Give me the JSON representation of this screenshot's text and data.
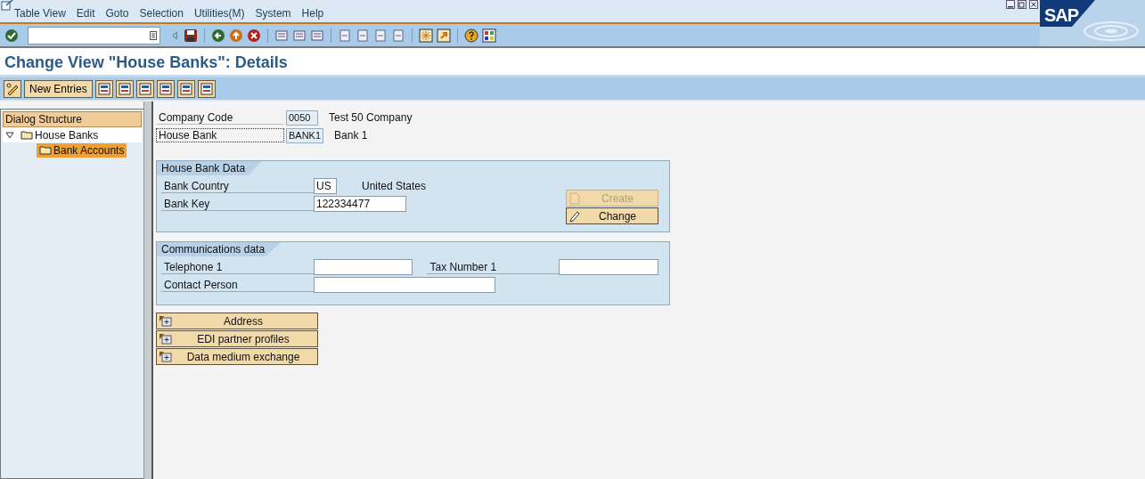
{
  "logo": "SAP",
  "menu": [
    "Table View",
    "Edit",
    "Goto",
    "Selection",
    "Utilities(M)",
    "System",
    "Help"
  ],
  "title": "Change View \"House Banks\": Details",
  "app_toolbar": {
    "new_entries": "New Entries"
  },
  "dialog_structure": {
    "title": "Dialog Structure",
    "items": [
      {
        "label": "House Banks",
        "expanded": true,
        "selected": false,
        "children": [
          {
            "label": "Bank Accounts",
            "selected": true
          }
        ]
      }
    ]
  },
  "header_fields": [
    {
      "label": "Company Code",
      "value": "0050",
      "description": "Test 50 Company",
      "focused": false
    },
    {
      "label": "House Bank",
      "value": "BANK1",
      "description": "Bank 1",
      "focused": true
    }
  ],
  "house_bank_data": {
    "title": "House Bank Data",
    "fields": [
      {
        "label": "Bank Country",
        "value": "US",
        "description": "United States"
      },
      {
        "label": "Bank Key",
        "value": "122334477"
      }
    ],
    "buttons": [
      {
        "label": "Create",
        "disabled": true
      },
      {
        "label": "Change",
        "disabled": false
      }
    ]
  },
  "communications": {
    "title": "Communications data",
    "rows": [
      [
        {
          "label": "Telephone 1",
          "wide": false
        },
        {
          "label": "Tax Number 1",
          "wide": false
        }
      ],
      [
        {
          "label": "Contact Person",
          "wide": true
        }
      ]
    ]
  },
  "expanders": [
    "Address",
    "EDI partner profiles",
    "Data medium exchange"
  ]
}
